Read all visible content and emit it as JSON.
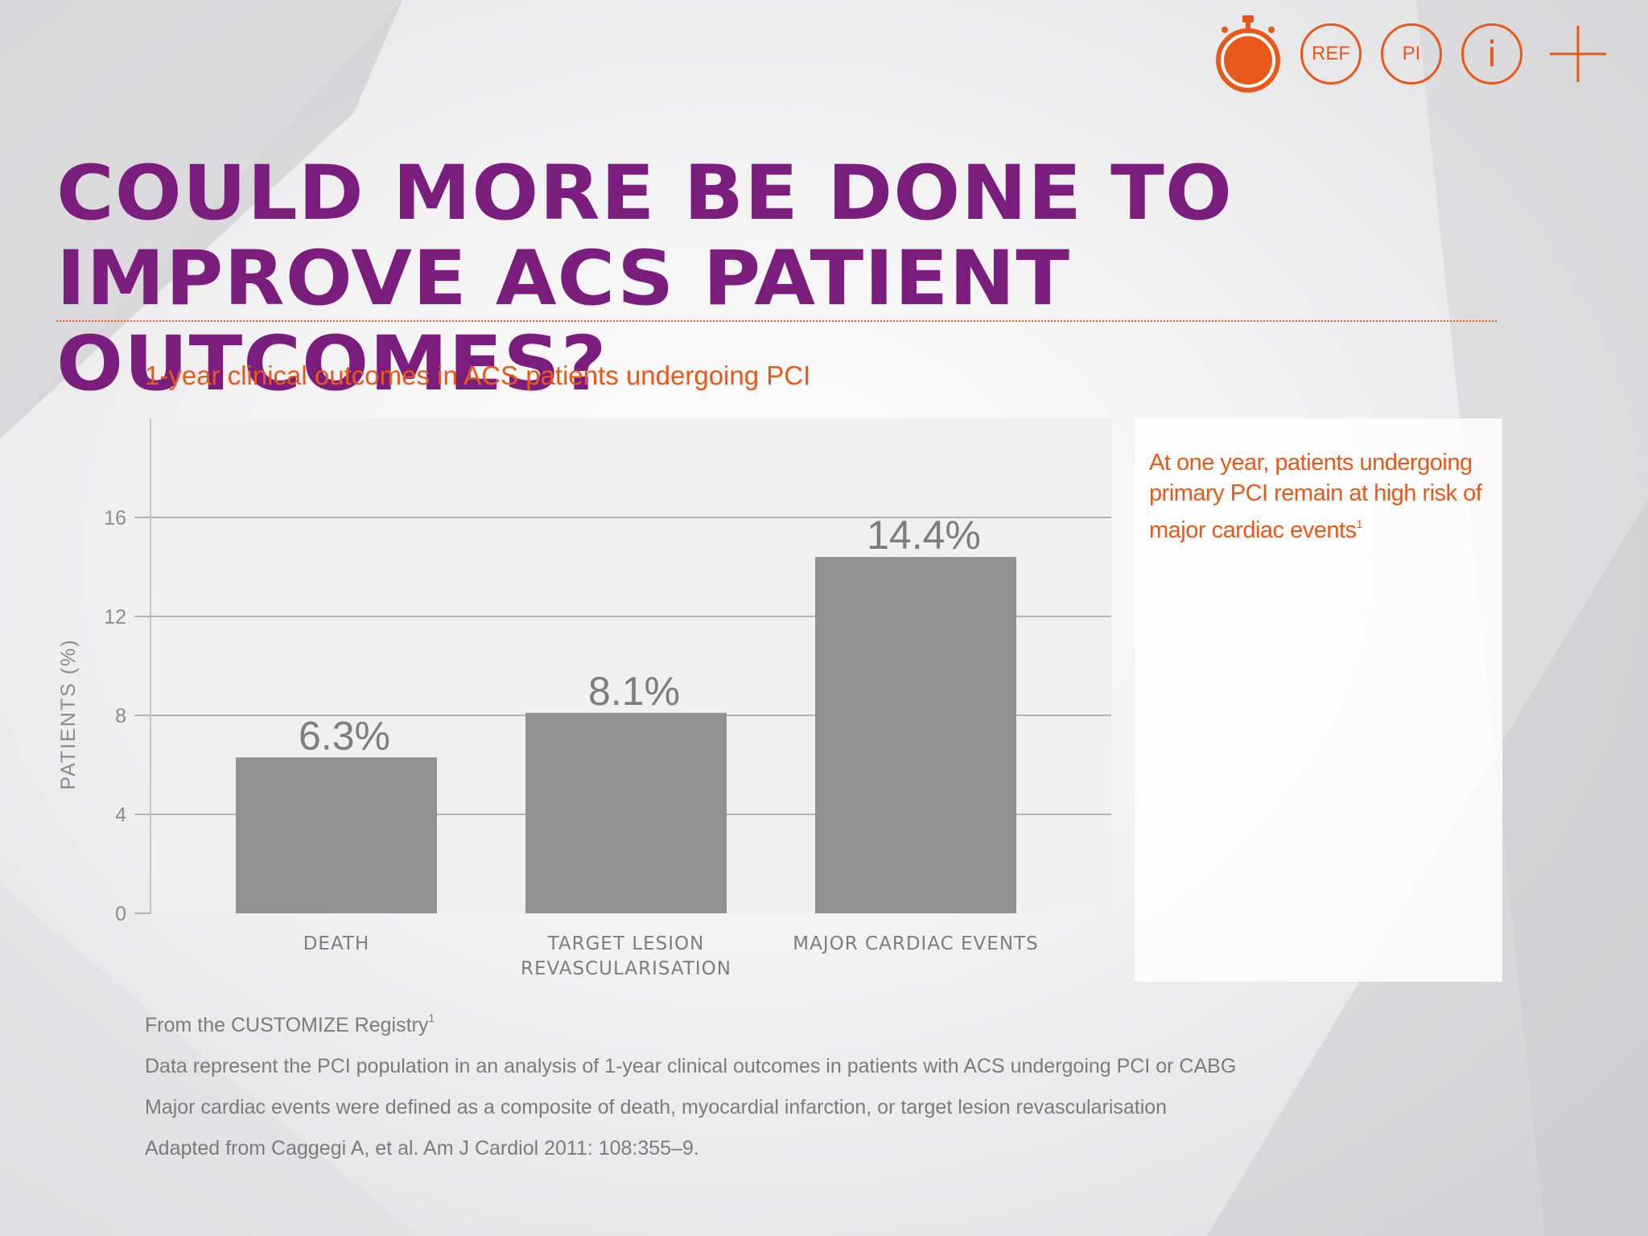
{
  "toolbar": {
    "timer_icon": "stopwatch-icon",
    "ref_label": "REF",
    "pi_label": "PI",
    "info_label": "i",
    "plus_icon": "plus-icon",
    "accent_color": "#e8581a"
  },
  "title": {
    "line1": "COULD MORE BE DONE TO",
    "line2": "IMPROVE ACS PATIENT OUTCOMES?",
    "color": "#7a1d7d"
  },
  "callout": {
    "text": "At one year, patients undergoing primary PCI remain at high risk of major cardiac events",
    "superscript": "1"
  },
  "footnotes": {
    "source_text": "From the CUSTOMIZE Registry",
    "source_sup": "1",
    "line2": "Data represent the PCI population in an analysis of 1-year clinical outcomes in patients with ACS undergoing PCI or CABG",
    "line3": "Major cardiac events were defined as a composite of death, myocardial infarction, or target lesion revascularisation",
    "line4": "Adapted from Caggegi A, et al. Am J Cardiol 2011: 108:355–9."
  },
  "chart_data": {
    "type": "bar",
    "title": "1-year clinical outcomes in ACS patients undergoing PCI",
    "xlabel": "",
    "ylabel": "PATIENTS (%)",
    "categories": [
      [
        "DEATH"
      ],
      [
        "TARGET LESION",
        "REVASCULARISATION"
      ],
      [
        "MAJOR CARDIAC EVENTS"
      ]
    ],
    "values": [
      6.3,
      8.1,
      14.4
    ],
    "data_labels": [
      "6.3%",
      "8.1%",
      "14.4%"
    ],
    "ylim": [
      0,
      20
    ],
    "yticks": [
      0,
      4,
      8,
      12,
      16
    ],
    "grid": true,
    "bar_color": "#919191",
    "plot_background": "#f0f0f0"
  }
}
